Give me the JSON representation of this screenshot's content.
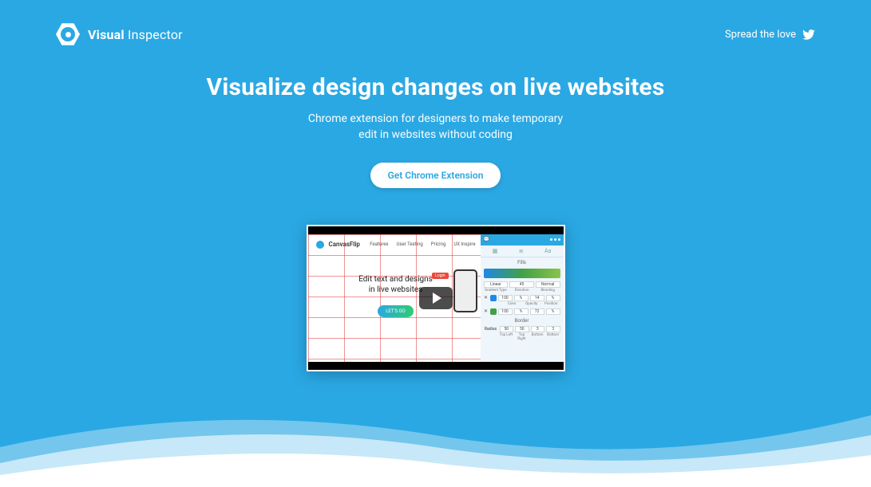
{
  "brand": {
    "strong": "Visual",
    "light": "Inspector"
  },
  "header": {
    "spread_label": "Spread the love"
  },
  "hero": {
    "title": "Visualize design changes on live websites",
    "subtitle_line1": "Chrome extension for designers to make temporary",
    "subtitle_line2": "edit in websites without coding",
    "cta": "Get Chrome Extension"
  },
  "video": {
    "brand": "CanvasFlip",
    "nav": {
      "features": "Features",
      "user_testing": "User Testing",
      "pricing": "Pricing",
      "ux_inspire": "UX Inspire"
    },
    "headline_line1": "Edit text and designs",
    "headline_line2": "in live websites",
    "letsgo": "LET'S GO",
    "login_badge": "Login",
    "panel": {
      "tab_fills": "Fills",
      "row1": {
        "a": "Linear",
        "b": "45",
        "c": "Normal"
      },
      "row1_labels": {
        "a": "Gradient Type",
        "b": "Direction",
        "c": "Blending"
      },
      "row2": {
        "a": "100",
        "b": "%",
        "c": "14",
        "d": "%"
      },
      "row2_labels": {
        "a": "Color",
        "b": "Opacity",
        "c": "Position"
      },
      "row3": {
        "a": "100",
        "b": "%",
        "c": "72",
        "d": "%"
      },
      "border_label": "Border",
      "radius": {
        "label": "Radius",
        "a": "50",
        "b": "50",
        "c": "3",
        "d": "3"
      },
      "radius_labels": {
        "a": "Top Left",
        "b": "Top Right",
        "c": "Bottom",
        "d": "Bottom"
      }
    }
  }
}
